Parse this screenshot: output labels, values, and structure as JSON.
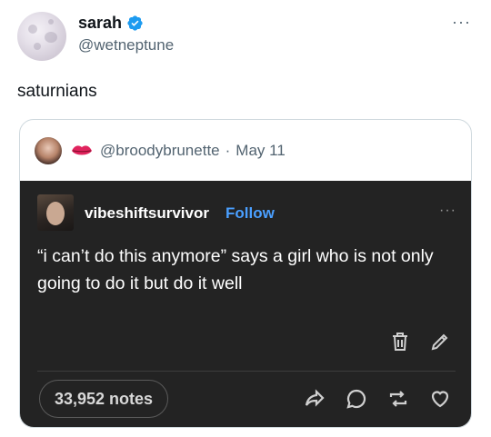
{
  "author": {
    "name": "sarah",
    "handle": "@wetneptune",
    "verified": true
  },
  "tweet": {
    "text": "saturnians"
  },
  "more_glyph": "···",
  "quoted": {
    "handle": "@broodybrunette",
    "separator": "·",
    "date": "May 11",
    "emoji": "lips"
  },
  "tumblr_post": {
    "username": "vibeshiftsurvivor",
    "follow_label": "Follow",
    "text": "“i can’t do this anymore” says a girl who is not only going to do it but do it well",
    "notes": "33,952 notes",
    "icons": [
      "trash-icon",
      "edit-icon",
      "share-icon",
      "reply-icon",
      "reblog-icon",
      "like-icon"
    ]
  },
  "colors": {
    "verified": "#1d9bf0",
    "follow": "#4a9fff",
    "tumblr_bg": "#232323"
  }
}
